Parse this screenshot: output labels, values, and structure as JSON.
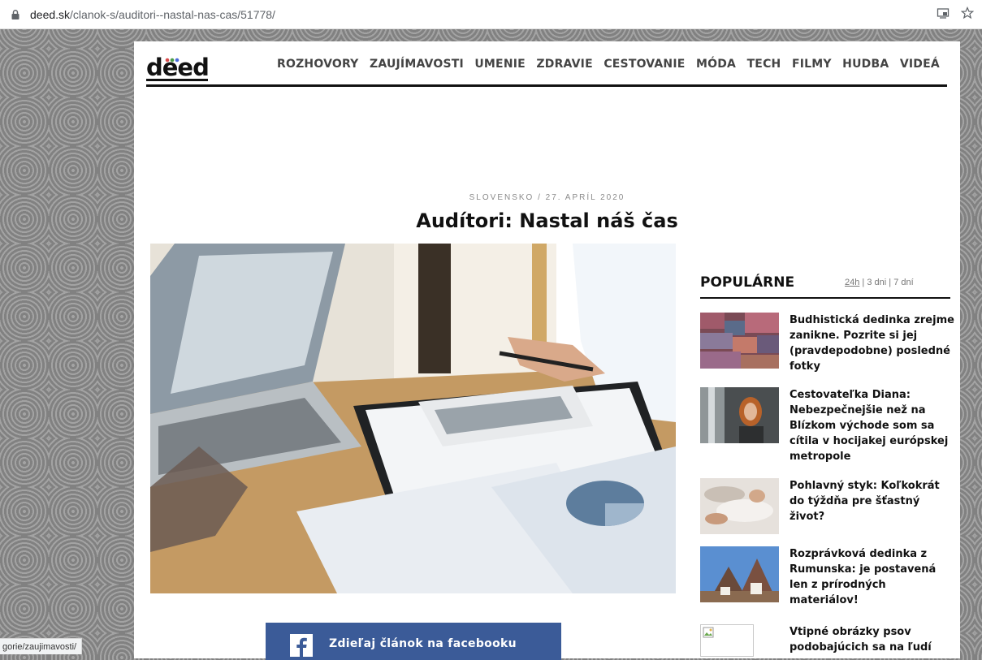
{
  "browser": {
    "url_domain": "deed.sk",
    "url_path": "/clanok-s/auditori--nastal-nas-cas/51778/",
    "status_url": "gorie/zaujimavosti/"
  },
  "site": {
    "logo_text": "deed",
    "logo_dot_colors": [
      "#d94b4b",
      "#4b9c4b",
      "#4b6bd9"
    ]
  },
  "nav": {
    "items": [
      "ROZHOVORY",
      "ZAUJÍMAVOSTI",
      "UMENIE",
      "ZDRAVIE",
      "CESTOVANIE",
      "MÓDA",
      "TECH",
      "FILMY",
      "HUDBA",
      "VIDEÁ"
    ]
  },
  "article": {
    "meta": "SLOVENSKO / 27. APRÍL 2020",
    "title": "Audítori: Nastal náš čas",
    "share_label": "Zdieľaj článok na facebooku"
  },
  "popular": {
    "heading": "POPULÁRNE",
    "tabs": [
      "24h",
      "3 dni",
      "7 dní"
    ],
    "items": [
      "Budhistická dedinka zrejme zanikne. Pozrite si jej (pravdepodobne) posledné fotky",
      "Cestovateľka Diana: Nebezpečnejšie než na Blízkom východe som sa cítila v hocijakej európskej metropole",
      "Pohlavný styk: Koľkokrát do týždňa pre šťastný život?",
      "Rozprávková dedinka z Rumunska: je postavená len z prírodných materiálov!",
      "Vtipné obrázky psov podobajúcich sa na ľudí"
    ]
  },
  "colors": {
    "facebook": "#3b5b98",
    "text": "#111111",
    "nav_text": "#444444",
    "meta_text": "#8a8a8a"
  }
}
